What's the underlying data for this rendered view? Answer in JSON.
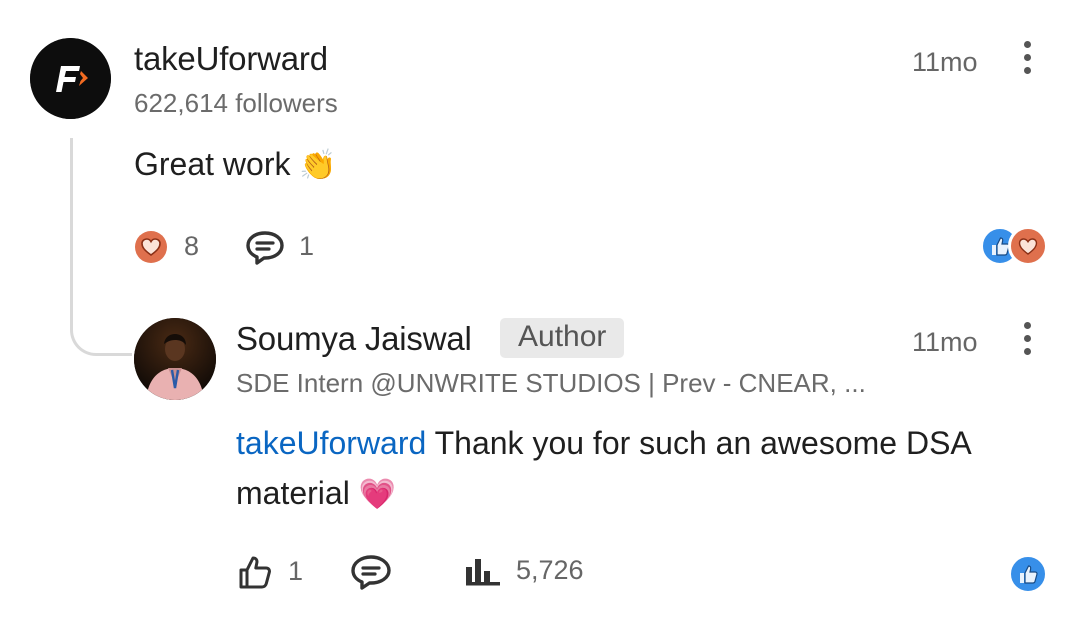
{
  "comment": {
    "author": "takeUforward",
    "followers": "622,614 followers",
    "time": "11mo",
    "text": "Great work",
    "emoji": "👏",
    "like_count": "8",
    "reply_count": "1",
    "reactions": [
      "like-icon",
      "love-icon"
    ]
  },
  "reply": {
    "author": "Soumya Jaiswal",
    "badge": "Author",
    "headline": "SDE Intern @UNWRITE STUDIOS | Prev - CNEAR, ...",
    "time": "11mo",
    "mention": "takeUforward",
    "text": " Thank you for such an awesome DSA",
    "text_line2": "material",
    "emoji": "💗",
    "like_count": "1",
    "impressions": "5,726",
    "reactions": [
      "like-icon"
    ]
  },
  "colors": {
    "accent_blue": "#0a66c2",
    "love_orange": "#df704d",
    "like_blue": "#378fe9"
  }
}
